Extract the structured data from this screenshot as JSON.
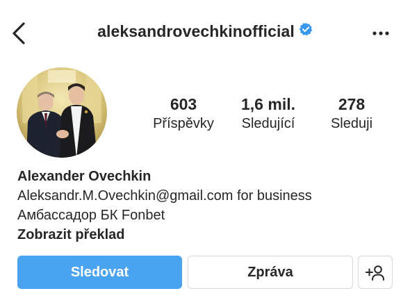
{
  "header": {
    "username": "aleksandrovechkinofficial",
    "verified_color": "#3897f0"
  },
  "avatar": {
    "description_icon": "profile-photo"
  },
  "stats": {
    "posts_count": "603",
    "posts_label": "Příspěvky",
    "followers_count": "1,6 mil.",
    "followers_label": "Sledující",
    "following_count": "278",
    "following_label": "Sleduji"
  },
  "bio": {
    "full_name": "Alexander Ovechkin",
    "line1": "Aleksandr.M.Ovechkin@gmail.com for business",
    "line2": "Амбассадор БК Fonbet",
    "translate_link": "Zobrazit překlad"
  },
  "actions": {
    "follow_label": "Sledovat",
    "message_label": "Zpráva",
    "follow_color": "#4aa3f0"
  }
}
